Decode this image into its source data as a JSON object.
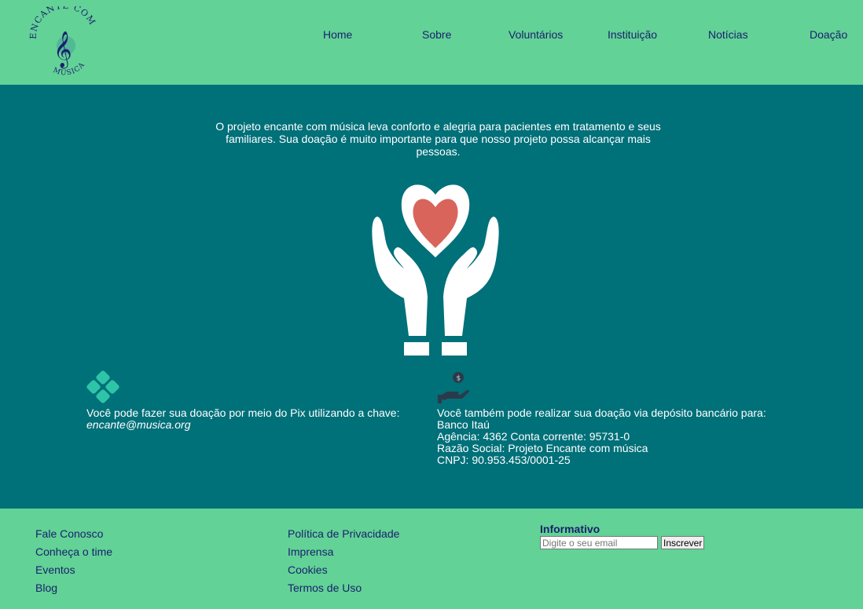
{
  "logo": {
    "top_text": "ENCANTE COM",
    "bottom_text": "MÚSICA"
  },
  "nav": {
    "items": [
      {
        "label": "Home"
      },
      {
        "label": "Sobre"
      },
      {
        "label": "Voluntários"
      },
      {
        "label": "Instituição"
      },
      {
        "label": "Notícias"
      },
      {
        "label": "Doação"
      }
    ]
  },
  "main": {
    "intro": "O projeto encante com música leva conforto e alegria para pacientes em tratamento e seus familiares. Sua doação é muito importante para que nosso projeto possa alcançar mais pessoas.",
    "pix": {
      "text": "Você pode fazer sua doação por meio do Pix utilizando a chave:",
      "key": "encante@musica.org"
    },
    "bank": {
      "intro": "Você também pode realizar sua doação via depósito bancário para:",
      "bank_name": "Banco Itaú",
      "account": "Agência: 4362 Conta corrente: 95731-0",
      "company": "Razão Social: Projeto Encante com música",
      "cnpj": "CNPJ: 90.953.453/0001-25"
    }
  },
  "footer": {
    "col1": [
      "Fale Conosco",
      "Conheça o time",
      "Eventos",
      "Blog"
    ],
    "col2": [
      "Política de Privacidade",
      "Imprensa",
      "Cookies",
      "Termos de Uso"
    ],
    "newsletter": {
      "title": "Informativo",
      "placeholder": "Digite o seu email",
      "button": "Inscrever"
    }
  },
  "colors": {
    "header_bg": "#62d296",
    "main_bg": "#007079",
    "link": "#1a1f6e",
    "heart": "#d9645c"
  }
}
